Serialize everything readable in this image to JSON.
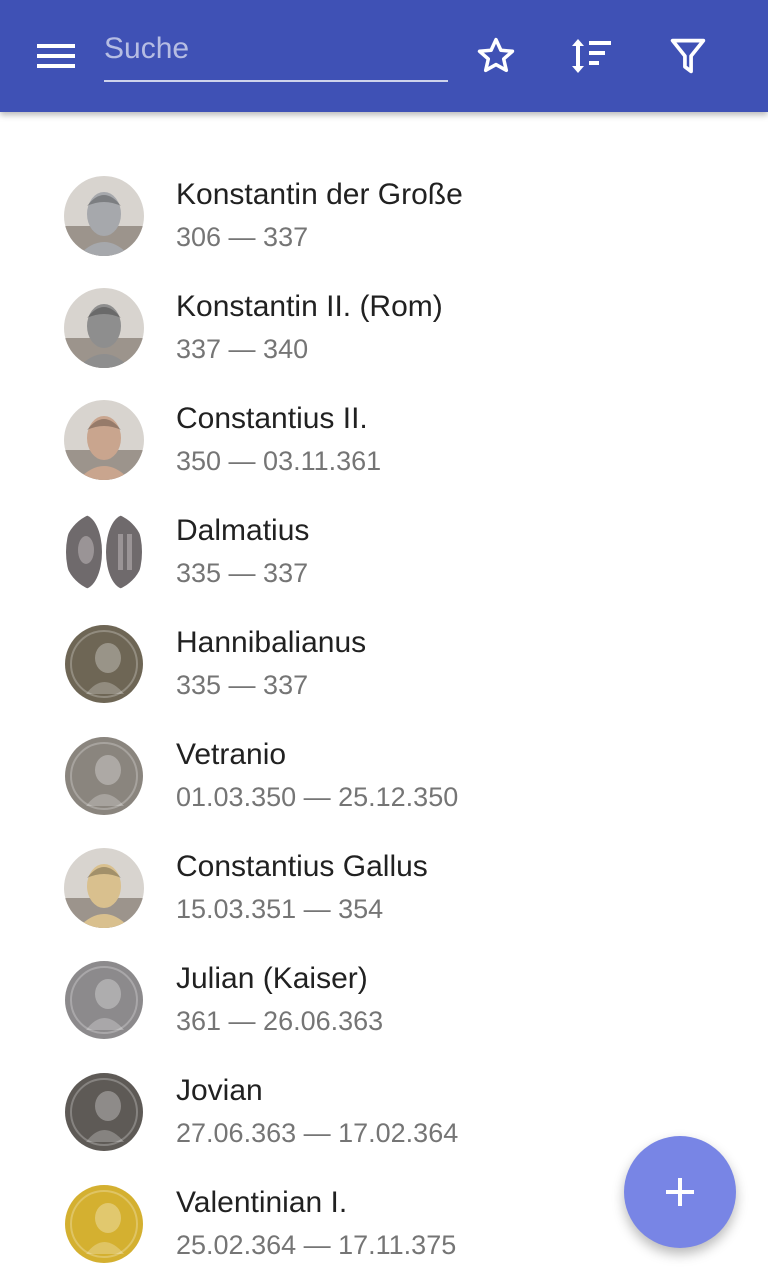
{
  "toolbar": {
    "menu_icon": "menu-icon",
    "search_placeholder": "Suche",
    "search_value": "",
    "favorites_icon": "star-outline-icon",
    "sort_icon": "sort-icon",
    "filter_icon": "filter-icon",
    "color": "#3f51b5"
  },
  "rulers": [
    {
      "name": "Konstantin der Große",
      "dates": "306 — 337",
      "avatar": "bust-icon",
      "tone": "#a6a8ac"
    },
    {
      "name": "Konstantin II. (Rom)",
      "dates": "337 — 340",
      "avatar": "statue-icon",
      "tone": "#8e8e8e"
    },
    {
      "name": "Constantius II.",
      "dates": "350 — 03.11.361",
      "avatar": "marble-head-icon",
      "tone": "#c9a58e"
    },
    {
      "name": "Dalmatius",
      "dates": "335 — 337",
      "avatar": "coin-pair-icon",
      "tone": "#6f6a6c"
    },
    {
      "name": "Hannibalianus",
      "dates": "335 — 337",
      "avatar": "bronze-coin-icon",
      "tone": "#6e6655"
    },
    {
      "name": "Vetranio",
      "dates": "01.03.350 — 25.12.350",
      "avatar": "bronze-coin-icon",
      "tone": "#8a857e"
    },
    {
      "name": "Constantius Gallus",
      "dates": "15.03.351 — 354",
      "avatar": "marble-head-icon",
      "tone": "#d9c08e"
    },
    {
      "name": "Julian (Kaiser)",
      "dates": "361 — 26.06.363",
      "avatar": "silver-coin-icon",
      "tone": "#8c8a8c"
    },
    {
      "name": "Jovian",
      "dates": "27.06.363 — 17.02.364",
      "avatar": "bronze-coin-icon",
      "tone": "#5e5a56"
    },
    {
      "name": "Valentinian I.",
      "dates": "25.02.364 — 17.11.375",
      "avatar": "gold-coin-icon",
      "tone": "#d4b030"
    }
  ],
  "fab": {
    "icon": "plus-icon",
    "color": "#7885e5"
  }
}
